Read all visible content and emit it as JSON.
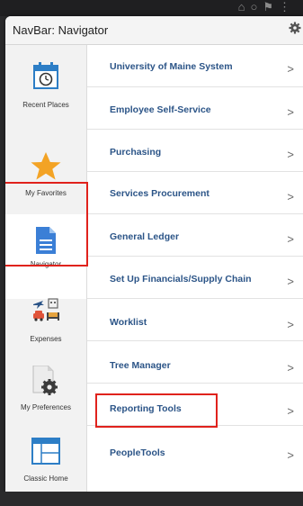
{
  "navbar": {
    "title": "NavBar: Navigator"
  },
  "tiles": [
    {
      "label": "Recent Places"
    },
    {
      "label": "My Favorites"
    },
    {
      "label": "Navigator"
    },
    {
      "label": "Expenses"
    },
    {
      "label": "My Preferences"
    },
    {
      "label": "Classic Home"
    }
  ],
  "menu_items": [
    {
      "label": "University of Maine System",
      "arrow": ">"
    },
    {
      "label": "Employee Self-Service",
      "arrow": ">"
    },
    {
      "label": "Purchasing",
      "arrow": ">"
    },
    {
      "label": "Services Procurement",
      "arrow": ">"
    },
    {
      "label": "General Ledger",
      "arrow": ">"
    },
    {
      "label": "Set Up Financials/Supply Chain",
      "arrow": ">"
    },
    {
      "label": "Worklist",
      "arrow": ">"
    },
    {
      "label": "Tree Manager",
      "arrow": ">"
    },
    {
      "label": "Reporting Tools",
      "arrow": ">"
    },
    {
      "label": "PeopleTools",
      "arrow": ">"
    }
  ],
  "colors": {
    "link": "#2b5487",
    "highlight": "#e0221c",
    "star": "#f3a325",
    "doc": "#3b7fd6"
  }
}
